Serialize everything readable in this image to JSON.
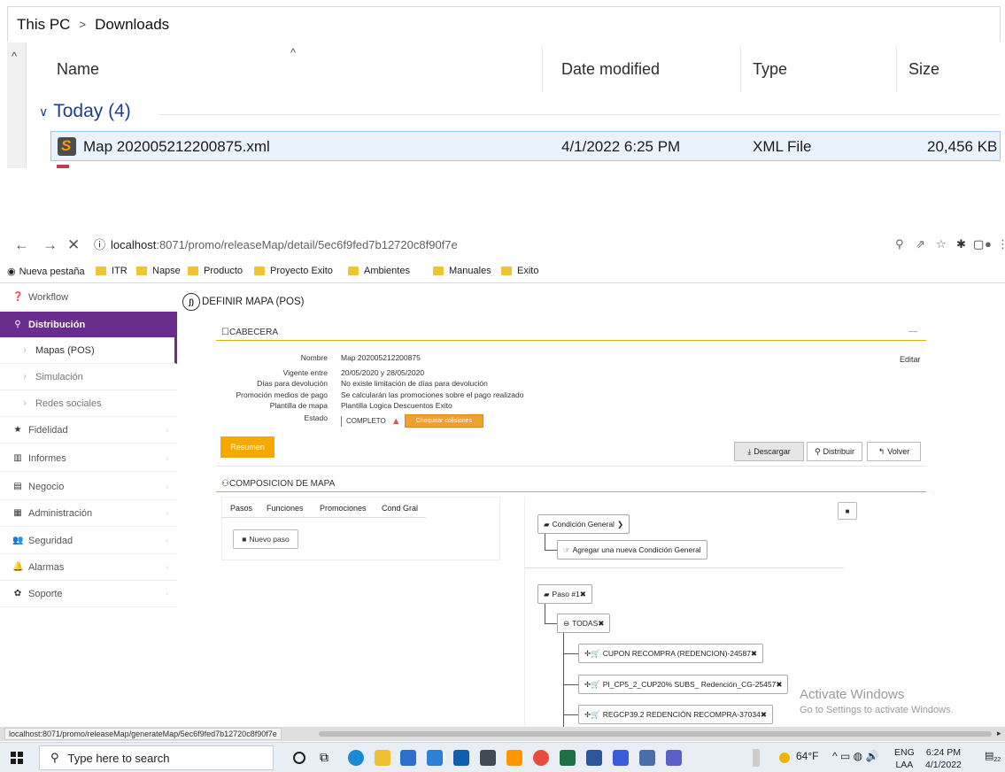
{
  "explorer": {
    "breadcrumb": [
      "This PC",
      "Downloads"
    ],
    "breadcrumb_sep": ">",
    "columns": {
      "name": "Name",
      "date": "Date modified",
      "type": "Type",
      "size": "Size"
    },
    "group_label": "Today (4)",
    "file": {
      "name": "Map 202005212200875.xml",
      "date": "4/1/2022 6:25 PM",
      "type": "XML File",
      "size": "20,456 KB"
    }
  },
  "browser": {
    "url_host": "localhost",
    "url_path": ":8071/promo/releaseMap/detail/5ec6f9fed7b12720c8f90f7e",
    "bookmarks": [
      "Nueva pestaña",
      "ITR",
      "Napse",
      "Producto",
      "Proyecto Exito",
      "Ambientes",
      "Manuales",
      "Exito"
    ],
    "status_url": "localhost:8071/promo/releaseMap/generateMap/5ec6f9fed7b12720c8f90f7e"
  },
  "sidebar": {
    "items": [
      {
        "label": "Workflow",
        "icon": "question-circle-icon"
      },
      {
        "label": "Distribución",
        "icon": "map-marker-icon"
      },
      {
        "label": "Mapas (POS)"
      },
      {
        "label": "Simulación"
      },
      {
        "label": "Redes sociales"
      },
      {
        "label": "Fidelidad",
        "icon": "star-icon"
      },
      {
        "label": "Informes",
        "icon": "bar-chart-icon"
      },
      {
        "label": "Negocio",
        "icon": "building-icon"
      },
      {
        "label": "Administración",
        "icon": "calendar-icon"
      },
      {
        "label": "Seguridad",
        "icon": "users-icon"
      },
      {
        "label": "Alarmas",
        "icon": "bell-icon"
      },
      {
        "label": "Soporte",
        "icon": "cog-icon"
      }
    ]
  },
  "main": {
    "title": "DEFINIR MAPA (POS)",
    "cabecera_label": "CABECERA",
    "cabecera_dash": "—",
    "fields": [
      {
        "k": "Nombre",
        "v": "Map 202005212200875"
      },
      {
        "k": "Vigente entre",
        "v": "20/05/2020 y 28/05/2020"
      },
      {
        "k": "Días para devolución",
        "v": "No existe limitación de días para devolución"
      },
      {
        "k": "Promoción medios de pago",
        "v": "Se calcularán las promociones sobre el pago realizado"
      },
      {
        "k": "Plantilla de mapa",
        "v": "Plantilla Logica Descuentos Exito"
      },
      {
        "k": "Estado",
        "v": ""
      }
    ],
    "estado": "COMPLETO",
    "chequear": "Chequear colisiones",
    "editar": "Editar",
    "resumen": "Resumen",
    "descargar": "Descargar",
    "distribuir": "Distribuir",
    "volver": "Volver",
    "composicion_label": "COMPOSICION DE MAPA",
    "tabs": [
      "Pasos",
      "Funciones",
      "Promociones",
      "Cond Gral"
    ],
    "nuevo_paso": "Nuevo paso",
    "tree": {
      "condicion_general": "Condición General",
      "agregar": "Agregar una nueva Condición General",
      "paso": "Paso #1",
      "todas": "TODAS",
      "items": [
        "CUPON RECOMPRA (REDENCION)-24587",
        "PI_CP5_2_CUP20% SUBS_ Redención_CG-25457",
        "REGCP39.2 REDENCIÓN RECOMPRA-37034"
      ]
    }
  },
  "watermark": {
    "line1": "Activate Windows",
    "line2": "Go to Settings to activate Windows."
  },
  "taskbar": {
    "search_placeholder": "Type here to search",
    "weather": "64°F",
    "lang": "ENG",
    "lang2": "LAA",
    "time": "6:24 PM",
    "date": "4/1/2022",
    "notif_count": "22"
  }
}
